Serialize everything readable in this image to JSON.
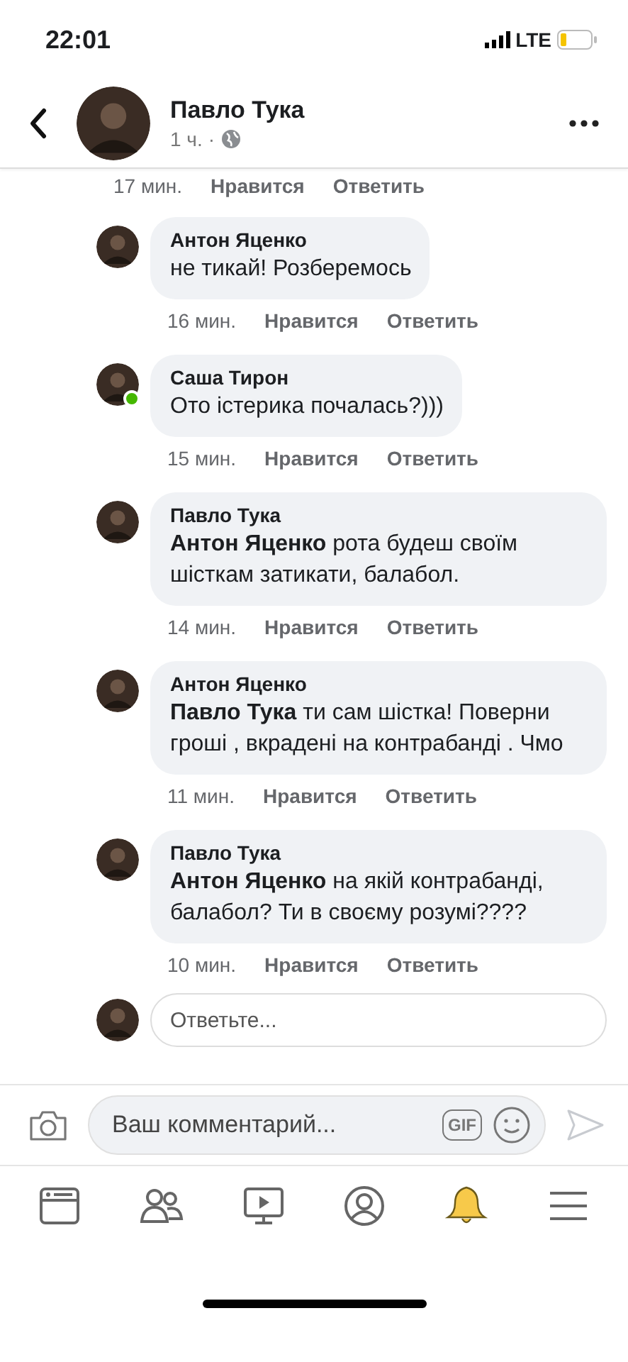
{
  "status_bar": {
    "time": "22:01",
    "network": "LTE"
  },
  "header": {
    "author": "Павло Тука",
    "time": "1 ч.",
    "separator": "·"
  },
  "hidden_actions": {
    "time": "17 мин.",
    "like": "Нравится",
    "reply": "Ответить"
  },
  "comments": [
    {
      "author": "Антон Яценко",
      "text": "не тикай!  Розберемось",
      "time": "16 мин.",
      "like": "Нравится",
      "reply": "Ответить",
      "online": false
    },
    {
      "author": "Саша Тирон",
      "text": "Ото істерика почалась?)))",
      "time": "15 мин.",
      "like": "Нравится",
      "reply": "Ответить",
      "online": true
    },
    {
      "author": "Павло Тука",
      "text": "**Антон Яценко** рота будеш своїм шісткам затикати, балабол.",
      "time": "14 мин.",
      "like": "Нравится",
      "reply": "Ответить",
      "online": false
    },
    {
      "author": "Антон Яценко",
      "text": "**Павло Тука** ти сам шістка! Поверни гроші , вкрадені на контрабанді . Чмо",
      "time": "11 мин.",
      "like": "Нравится",
      "reply": "Ответить",
      "online": false
    },
    {
      "author": "Павло Тука",
      "text": "**Антон Яценко** на якій контрабанді, балабол? Ти в своєму розумі????",
      "time": "10 мин.",
      "like": "Нравится",
      "reply": "Ответить",
      "online": false
    }
  ],
  "reply_field": {
    "placeholder": "Ответьте..."
  },
  "comment_field": {
    "placeholder": "Ваш комментарий...",
    "gif": "GIF"
  },
  "tabs": [
    {
      "kind": "feed",
      "selected": false
    },
    {
      "kind": "friends",
      "selected": false
    },
    {
      "kind": "watch",
      "selected": false
    },
    {
      "kind": "profile",
      "selected": false
    },
    {
      "kind": "notifications",
      "selected": true
    },
    {
      "kind": "menu",
      "selected": false
    }
  ]
}
